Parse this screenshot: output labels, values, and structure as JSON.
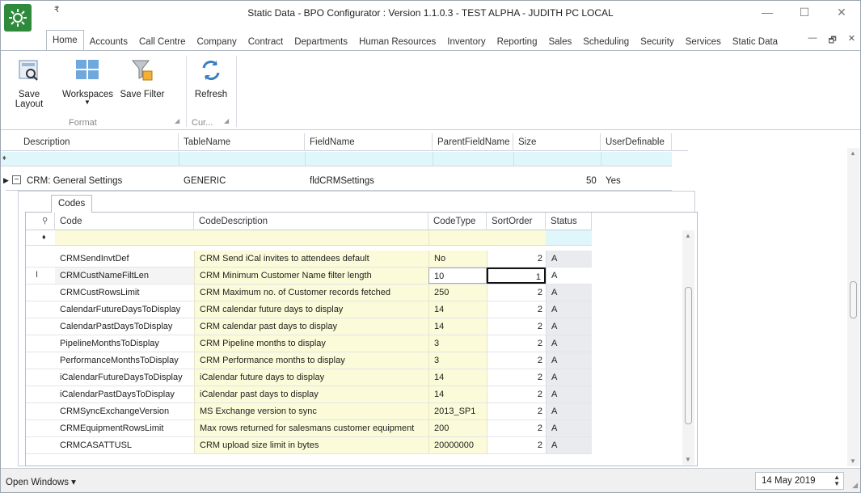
{
  "window": {
    "title": "Static Data - BPO Configurator : Version 1.1.0.3 - TEST ALPHA - JUDITH PC LOCAL",
    "qat_symbol": "₹",
    "minimize": "—",
    "maximize": "☐",
    "close": "✕"
  },
  "menu_tabs": [
    "Home",
    "Accounts",
    "Call Centre",
    "Company",
    "Contract",
    "Departments",
    "Human Resources",
    "Inventory",
    "Reporting",
    "Sales",
    "Scheduling",
    "Security",
    "Services",
    "Static Data"
  ],
  "mdi": {
    "minimize": "—",
    "restore": "🗗",
    "close": "✕"
  },
  "ribbon": {
    "save_layout": "Save Layout",
    "workspaces": "Workspaces",
    "save_filter": "Save Filter",
    "refresh": "Refresh",
    "group_format": "Format",
    "group_cur": "Cur..."
  },
  "master_grid": {
    "columns": [
      "Description",
      "TableName",
      "FieldName",
      "ParentFieldName",
      "Size",
      "UserDefinable"
    ],
    "row": {
      "description": "CRM: General Settings",
      "table_name": "GENERIC",
      "field_name": "fldCRMSettings",
      "parent_field_name": "",
      "size": "50",
      "user_definable": "Yes"
    }
  },
  "detail": {
    "tab_label": "Codes",
    "columns": [
      "Code",
      "CodeDescription",
      "CodeType",
      "SortOrder",
      "Status"
    ],
    "rows": [
      {
        "code": "CRMSendInvtDef",
        "desc": "CRM Send iCal invites to attendees default",
        "type": "No",
        "sort": "2",
        "status": "A"
      },
      {
        "code": "CRMCustNameFiltLen",
        "desc": "CRM Minimum Customer Name filter length",
        "type": "10",
        "sort": "1",
        "status": "A"
      },
      {
        "code": "CRMCustRowsLimit",
        "desc": "CRM Maximum no. of Customer records fetched",
        "type": "250",
        "sort": "2",
        "status": "A"
      },
      {
        "code": "CalendarFutureDaysToDisplay",
        "desc": "CRM calendar future days to display",
        "type": "14",
        "sort": "2",
        "status": "A"
      },
      {
        "code": "CalendarPastDaysToDisplay",
        "desc": "CRM calendar past days to display",
        "type": "14",
        "sort": "2",
        "status": "A"
      },
      {
        "code": "PipelineMonthsToDisplay",
        "desc": "CRM Pipeline months to display",
        "type": "3",
        "sort": "2",
        "status": "A"
      },
      {
        "code": "PerformanceMonthsToDisplay",
        "desc": "CRM Performance months to display",
        "type": "3",
        "sort": "2",
        "status": "A"
      },
      {
        "code": "iCalendarFutureDaysToDisplay",
        "desc": "iCalendar future days to display",
        "type": "14",
        "sort": "2",
        "status": "A"
      },
      {
        "code": "iCalendarPastDaysToDisplay",
        "desc": "iCalendar past days to display",
        "type": "14",
        "sort": "2",
        "status": "A"
      },
      {
        "code": "CRMSyncExchangeVersion",
        "desc": "MS Exchange version to sync",
        "type": "2013_SP1",
        "sort": "2",
        "status": "A"
      },
      {
        "code": "CRMEquipmentRowsLimit",
        "desc": "Max rows returned for salesmans customer equipment",
        "type": "200",
        "sort": "2",
        "status": "A"
      },
      {
        "code": "CRMCASATTUSL",
        "desc": "CRM upload size limit in bytes",
        "type": "20000000",
        "sort": "2",
        "status": "A"
      }
    ]
  },
  "statusbar": {
    "open_windows": "Open Windows ▾",
    "date": "14 May 2019"
  },
  "colors": {
    "filter_cyan": "#dff6fb",
    "editable_yellow": "#fbfbd9",
    "app_icon_green": "#2f8a3c"
  }
}
